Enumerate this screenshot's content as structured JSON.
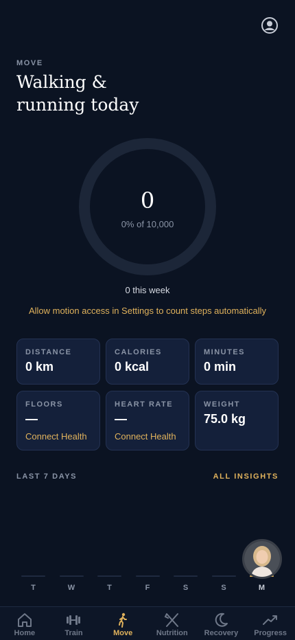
{
  "header": {
    "eyebrow": "MOVE",
    "title": "Walking & running today"
  },
  "ring": {
    "value": "0",
    "subtitle": "0% of 10,000",
    "progress": 0
  },
  "week_total": "0 this week",
  "motion_note": "Allow motion access in Settings to count steps automatically",
  "stats": [
    {
      "label": "DISTANCE",
      "value": "0 km"
    },
    {
      "label": "CALORIES",
      "value": "0 kcal"
    },
    {
      "label": "MINUTES",
      "value": "0 min"
    },
    {
      "label": "FLOORS",
      "value": "—",
      "link": "Connect Health"
    },
    {
      "label": "HEART RATE",
      "value": "—",
      "link": "Connect Health"
    },
    {
      "label": "WEIGHT",
      "value": "75.0 kg"
    }
  ],
  "insights": {
    "title": "LAST 7 DAYS",
    "link": "ALL INSIGHTS"
  },
  "days": [
    "T",
    "W",
    "T",
    "F",
    "S",
    "S",
    "M"
  ],
  "tabs": [
    {
      "label": "Home",
      "icon": "home-icon"
    },
    {
      "label": "Train",
      "icon": "dumbbell-icon"
    },
    {
      "label": "Move",
      "icon": "walking-icon"
    },
    {
      "label": "Nutrition",
      "icon": "utensils-icon"
    },
    {
      "label": "Recovery",
      "icon": "moon-icon"
    },
    {
      "label": "Progress",
      "icon": "trend-icon"
    }
  ],
  "colors": {
    "background": "#0b1322",
    "accent": "#e0b25c",
    "card": "#14203a"
  }
}
